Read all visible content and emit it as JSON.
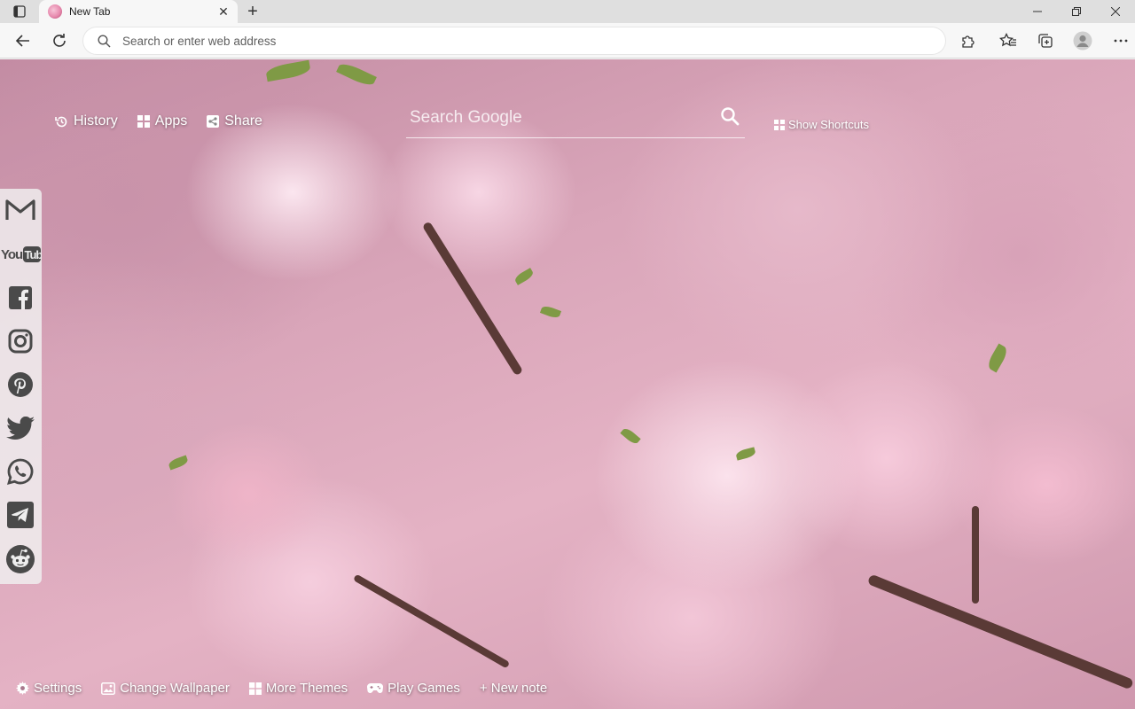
{
  "browser": {
    "tab": {
      "title": "New Tab",
      "favicon": "cherry-blossom-favicon"
    },
    "new_tab_symbol": "+",
    "close_symbol": "✕",
    "address_bar": {
      "placeholder": "Search or enter web address",
      "value": ""
    },
    "toolbar_icons": [
      "back-icon",
      "refresh-icon",
      "extensions-icon",
      "favorites-icon",
      "collections-icon",
      "profile-icon",
      "more-icon"
    ],
    "window_controls": [
      "minimize",
      "restore",
      "close"
    ]
  },
  "newtab": {
    "top_links": [
      {
        "label": "History",
        "icon": "history-icon"
      },
      {
        "label": "Apps",
        "icon": "apps-icon"
      },
      {
        "label": "Share",
        "icon": "share-icon"
      }
    ],
    "search": {
      "placeholder": "Search Google",
      "icon": "search-icon"
    },
    "shortcuts": {
      "label": "Show Shortcuts",
      "icon": "grid-icon"
    },
    "social": [
      {
        "name": "Gmail",
        "icon": "gmail-icon"
      },
      {
        "name": "YouTube",
        "icon": "youtube-icon",
        "text": "YouTube"
      },
      {
        "name": "Facebook",
        "icon": "facebook-icon"
      },
      {
        "name": "Instagram",
        "icon": "instagram-icon"
      },
      {
        "name": "Pinterest",
        "icon": "pinterest-icon"
      },
      {
        "name": "Twitter",
        "icon": "twitter-icon"
      },
      {
        "name": "WhatsApp",
        "icon": "whatsapp-icon"
      },
      {
        "name": "Telegram",
        "icon": "telegram-icon"
      },
      {
        "name": "Reddit",
        "icon": "reddit-icon"
      }
    ],
    "bottom_links": [
      {
        "label": "Settings",
        "icon": "gear-icon"
      },
      {
        "label": "Change Wallpaper",
        "icon": "image-icon"
      },
      {
        "label": "More Themes",
        "icon": "windows-grid-icon"
      },
      {
        "label": "Play Games",
        "icon": "gamepad-icon"
      },
      {
        "label": "+ New note",
        "icon": ""
      }
    ],
    "wallpaper": "pink cherry blossoms",
    "colors": {
      "social_icon": "#4a4a4a",
      "overlay_text": "#ffffff"
    }
  }
}
